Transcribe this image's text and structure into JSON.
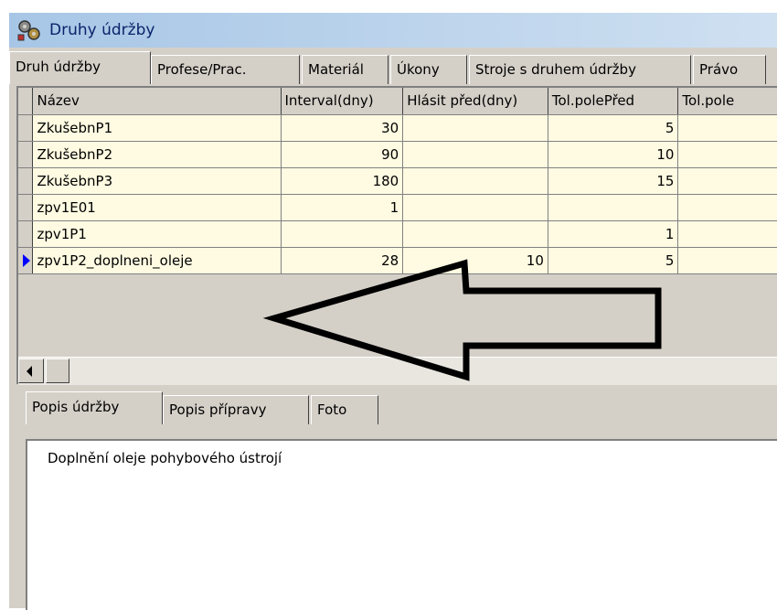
{
  "window": {
    "title": "Druhy údržby",
    "icon": "gears-icon"
  },
  "tabs": [
    {
      "label": "Druh údržby",
      "active": true
    },
    {
      "label": "Profese/Prac."
    },
    {
      "label": "Materiál"
    },
    {
      "label": "Úkony"
    },
    {
      "label": "Stroje s druhem údržby"
    },
    {
      "label": "Právo"
    }
  ],
  "grid": {
    "columns": [
      "Název",
      "Interval(dny)",
      "Hlásit před(dny)",
      "Tol.polePřed",
      "Tol.pole"
    ],
    "rows": [
      {
        "nazev": "ZkušebnP1",
        "interval": "30",
        "hlasit": "",
        "tol_pred": "5",
        "tol": ""
      },
      {
        "nazev": "ZkušebnP2",
        "interval": "90",
        "hlasit": "",
        "tol_pred": "10",
        "tol": ""
      },
      {
        "nazev": "ZkušebnP3",
        "interval": "180",
        "hlasit": "",
        "tol_pred": "15",
        "tol": ""
      },
      {
        "nazev": "zpv1E01",
        "interval": "1",
        "hlasit": "",
        "tol_pred": "",
        "tol": ""
      },
      {
        "nazev": "zpv1P1",
        "interval": "",
        "hlasit": "",
        "tol_pred": "1",
        "tol": ""
      },
      {
        "nazev": "zpv1P2_doplneni_oleje",
        "interval": "28",
        "hlasit": "10",
        "tol_pred": "5",
        "tol": "",
        "current": true
      }
    ]
  },
  "bottom_tabs": [
    {
      "label": "Popis údržby",
      "active": true
    },
    {
      "label": "Popis přípravy"
    },
    {
      "label": "Foto"
    }
  ],
  "description": {
    "text": "Doplnění oleje pohybového ústrojí"
  },
  "colors": {
    "grid_bg": "#fffbe2",
    "title_fg": "#0a246a",
    "row_pointer": "#0000ff"
  }
}
